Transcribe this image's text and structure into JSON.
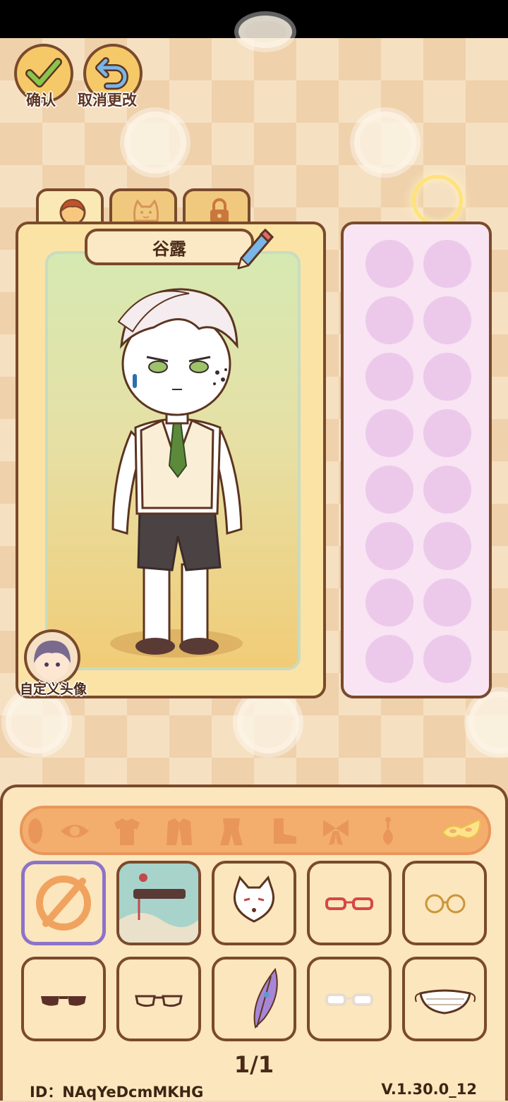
{
  "toolbar": {
    "confirm_label": "确认",
    "cancel_label": "取消更改"
  },
  "tabs": [
    {
      "icon": "character-face-icon",
      "active": true
    },
    {
      "icon": "cat-face-icon",
      "active": false
    },
    {
      "icon": "lock-icon",
      "active": false
    }
  ],
  "character": {
    "name": "谷露",
    "custom_avatar_label": "自定义头像"
  },
  "categories": [
    {
      "icon": "hair-icon"
    },
    {
      "icon": "eye-icon"
    },
    {
      "icon": "shirt-icon"
    },
    {
      "icon": "coat-icon"
    },
    {
      "icon": "outfit-icon"
    },
    {
      "icon": "boots-icon"
    },
    {
      "icon": "bow-icon"
    },
    {
      "icon": "earring-icon"
    },
    {
      "icon": "mask-icon",
      "active": true
    }
  ],
  "items": [
    {
      "icon": "none-icon",
      "selected": true
    },
    {
      "icon": "hairpin-accessory-icon"
    },
    {
      "icon": "fox-mask-icon"
    },
    {
      "icon": "red-glasses-icon"
    },
    {
      "icon": "round-glasses-icon"
    },
    {
      "icon": "sunglasses-icon"
    },
    {
      "icon": "thin-glasses-icon"
    },
    {
      "icon": "feather-icon"
    },
    {
      "icon": "white-glasses-icon"
    },
    {
      "icon": "face-mask-icon"
    }
  ],
  "pagination": "1/1",
  "footer": {
    "id_text": "ID：NAqYeDcmMKHG",
    "version": "V.1.30.0_12"
  }
}
